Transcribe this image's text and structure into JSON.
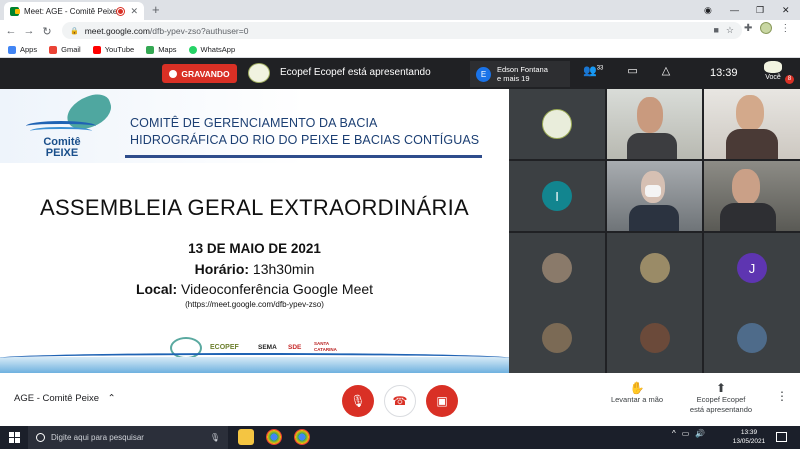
{
  "browser": {
    "tab_title": "Meet: AGE - Comitê Peixe",
    "url_host": "meet.google.com",
    "url_path": "/dfb-ypev-zso?authuser=0",
    "bookmarks": [
      "Apps",
      "Gmail",
      "YouTube",
      "Maps",
      "WhatsApp"
    ]
  },
  "meet_top": {
    "recording_label": "GRAVANDO",
    "presenting_text": "Ecopef Ecopef está apresentando",
    "user_chip_initial": "E",
    "user_chip_line1": "Edson Fontana",
    "user_chip_line2": "e mais 19",
    "participants_count": "33",
    "clock": "13:39",
    "self_label": "Você",
    "self_badge": "8"
  },
  "slide": {
    "brand_line1": "Comitê",
    "brand_line2": "PEIXE",
    "committee_line1": "COMITÊ DE GERENCIAMENTO DA BACIA",
    "committee_line2": "HIDROGRÁFICA DO RIO DO PEIXE E BACIAS CONTÍGUAS",
    "assembly_title": "ASSEMBLEIA GERAL EXTRAORDINÁRIA",
    "date": "13 DE MAIO DE 2021",
    "time_label": "Horário:",
    "time_value": " 13h30min",
    "place_label": "Local:",
    "place_value": " Videoconferência Google Meet",
    "url": "(https://meet.google.com/dfb-ypev-zso)",
    "footer_logos": [
      "ECOPEF",
      "SEMA",
      "SDE",
      "SANTA CATARINA"
    ]
  },
  "participants": {
    "initial_I": "I",
    "initial_J": "J"
  },
  "meet_bottom": {
    "meeting_name": "AGE - Comitê Peixe",
    "raise_hand": "Levantar a mão",
    "presenter_line1": "Ecopef Ecopef",
    "presenter_line2": "está apresentando"
  },
  "taskbar": {
    "search_placeholder": "Digite aqui para pesquisar",
    "time": "13:39",
    "date": "13/05/2021"
  },
  "colors": {
    "recording_red": "#d93025",
    "meet_dark": "#202124",
    "slide_blue": "#1c3f73"
  }
}
